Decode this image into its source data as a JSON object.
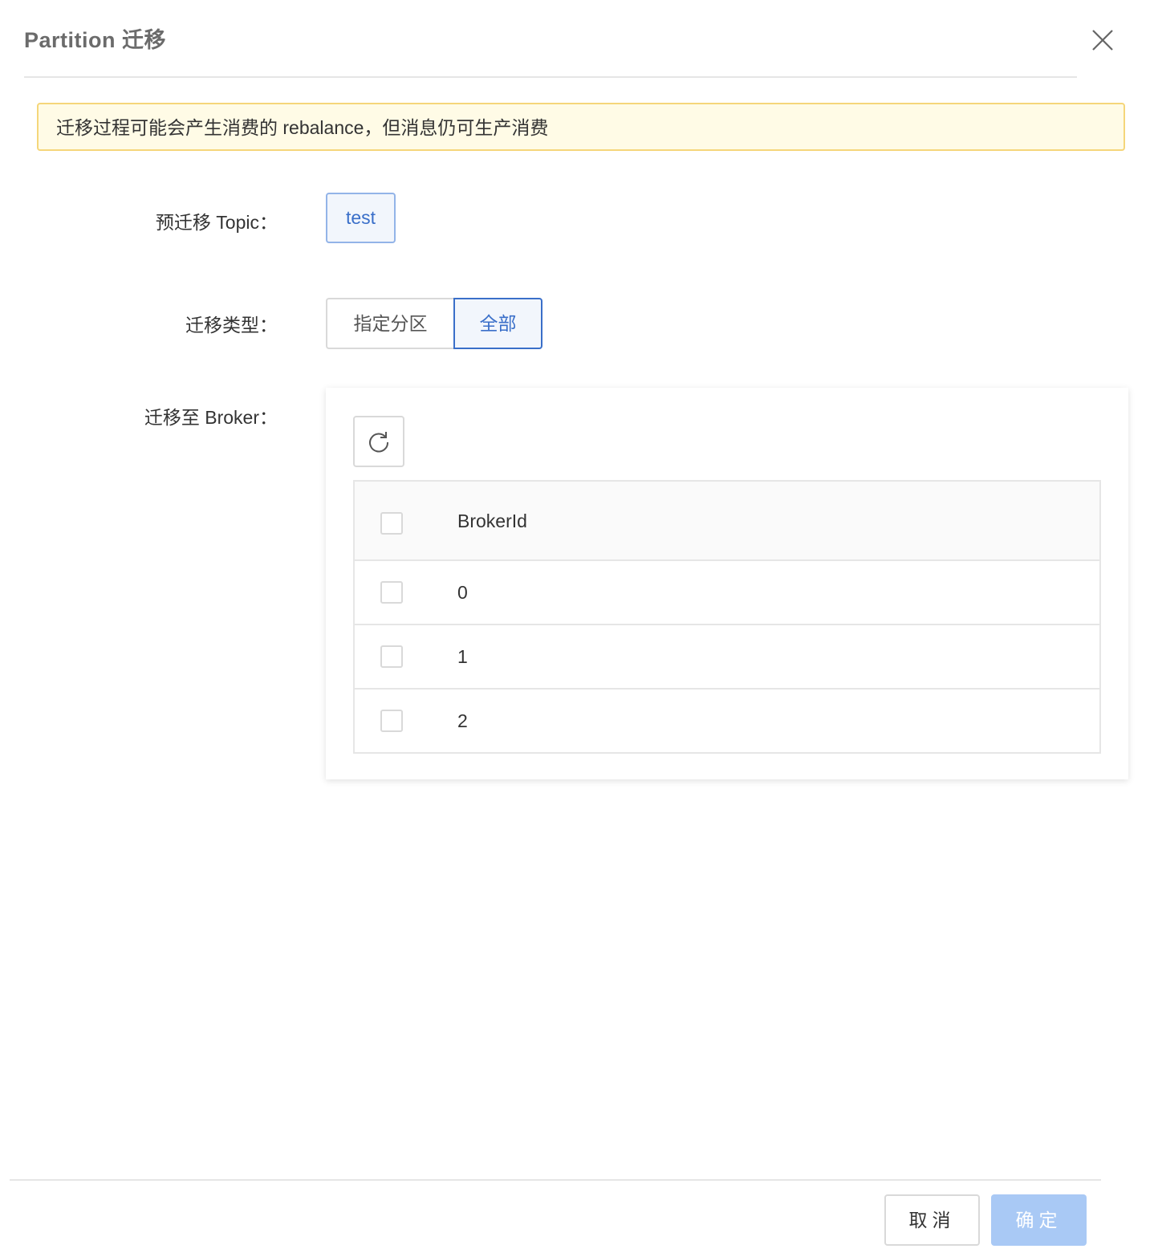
{
  "dialog": {
    "title": "Partition 迁移",
    "close_icon": "close-icon"
  },
  "alert": {
    "message": "迁移过程可能会产生消费的 rebalance，但消息仍可生产消费"
  },
  "form": {
    "topic_label": "预迁移 Topic：",
    "topic_value": "test",
    "type_label": "迁移类型：",
    "type_options": [
      "指定分区",
      "全部"
    ],
    "type_selected": "全部",
    "broker_label": "迁移至 Broker：",
    "refresh_icon": "refresh-icon",
    "broker_table": {
      "header": "BrokerId",
      "rows": [
        "0",
        "1",
        "2"
      ]
    }
  },
  "footer": {
    "cancel_label": "取消",
    "confirm_label": "确定"
  },
  "colors": {
    "primary": "#3a6fc9",
    "alert_bg": "#fffbe6",
    "alert_border": "#f5d67a",
    "confirm_disabled": "#a9c9f5"
  }
}
